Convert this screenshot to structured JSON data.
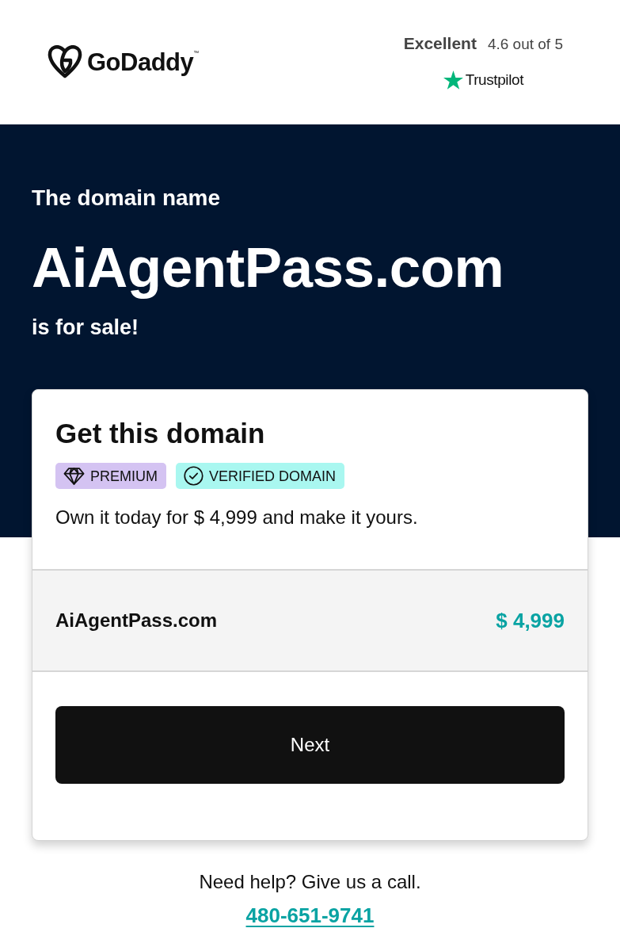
{
  "header": {
    "logo": {
      "wordmark": "GoDaddy",
      "trademark": "™"
    },
    "rating": {
      "label": "Excellent",
      "score": "4.6 out of 5",
      "provider": "Trustpilot"
    }
  },
  "hero": {
    "intro": "The domain name",
    "domain": "AiAgentPass.com",
    "outro": "is for sale!"
  },
  "card": {
    "title": "Get this domain",
    "badges": [
      {
        "kind": "premium",
        "label": "PREMIUM"
      },
      {
        "kind": "verified",
        "label": "VERIFIED DOMAIN"
      }
    ],
    "description": "Own it today for $ 4,999 and make it yours.",
    "item": {
      "name": "AiAgentPass.com",
      "price": "$ 4,999"
    },
    "button": "Next"
  },
  "footer": {
    "help": "Need help? Give us a call.",
    "phone": "480-651-9741"
  }
}
